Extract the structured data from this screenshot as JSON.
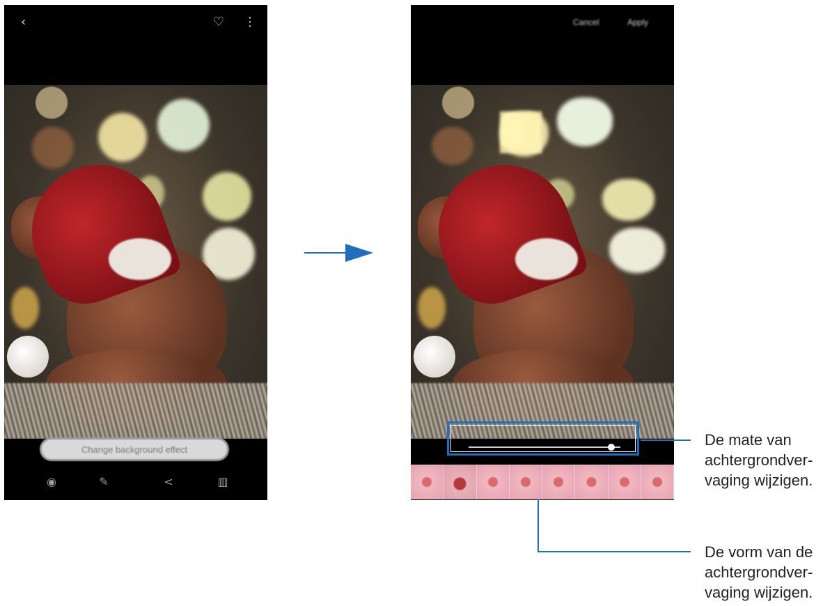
{
  "left_phone": {
    "change_background_button": "Change background effect"
  },
  "right_phone": {
    "cancel_label": "Cancel",
    "apply_label": "Apply",
    "blur_level": 0.96,
    "effect_count": 8,
    "selected_effect_index": 1
  },
  "callouts": {
    "blur_strength": [
      "De mate van",
      "achtergrondver-",
      "vaging wijzigen."
    ],
    "blur_shape": [
      "De vorm van de",
      "achtergrondver-",
      "vaging wijzigen."
    ]
  },
  "colors": {
    "accent_blue": "#1f6fbf",
    "phone_background": "#000000"
  },
  "icons": {
    "left_top": [
      "back-icon",
      "heart-icon",
      "more-options-icon"
    ],
    "left_bottom": [
      "view-icon",
      "edit-icon",
      "share-icon",
      "delete-icon"
    ]
  }
}
